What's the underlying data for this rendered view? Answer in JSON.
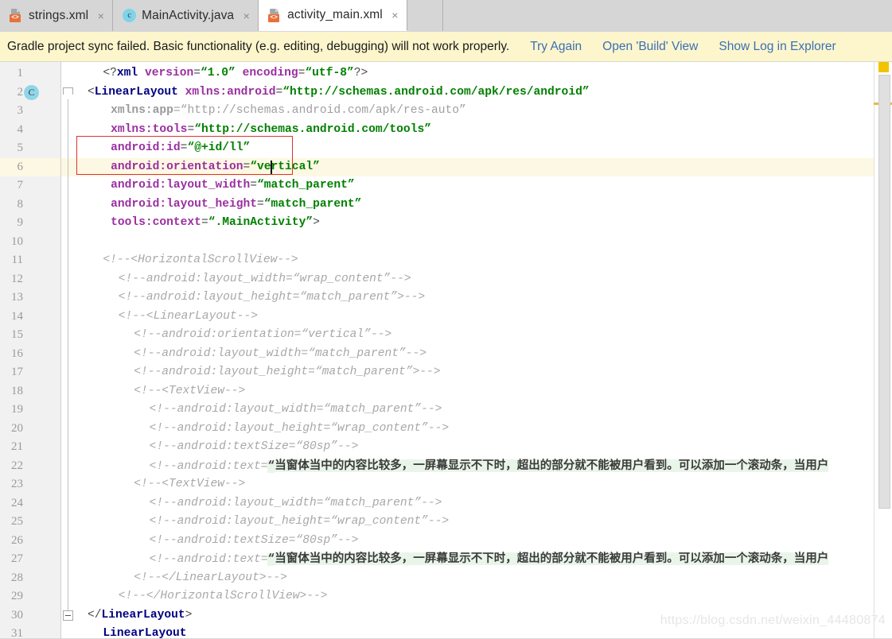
{
  "tabs": [
    {
      "label": "strings.xml",
      "icon": "xml-file-icon",
      "active": false,
      "close": "×"
    },
    {
      "label": "MainActivity.java",
      "icon": "java-class-icon",
      "active": false,
      "close": "×"
    },
    {
      "label": "activity_main.xml",
      "icon": "xml-file-icon",
      "active": true,
      "close": "×"
    }
  ],
  "notification": {
    "message": "Gradle project sync failed. Basic functionality (e.g. editing, debugging) will not work properly.",
    "links": [
      "Try Again",
      "Open 'Build' View",
      "Show Log in Explorer"
    ],
    "background": "#fdf6cd"
  },
  "editor": {
    "current_line": 6,
    "gutter_class_marker": "C",
    "caret_after": "vertical",
    "lines": [
      {
        "n": 1,
        "indent": 2,
        "segs": [
          {
            "t": "&lt;?",
            "c": "t-punc"
          },
          {
            "t": "xml",
            "c": "t-tag"
          },
          {
            "t": " ",
            "c": "t-punc"
          },
          {
            "t": "version",
            "c": "t-attr"
          },
          {
            "t": "=",
            "c": "t-punc"
          },
          {
            "t": "“1.0”",
            "c": "t-val"
          },
          {
            "t": " ",
            "c": "t-punc"
          },
          {
            "t": "encoding",
            "c": "t-attr"
          },
          {
            "t": "=",
            "c": "t-punc"
          },
          {
            "t": "“utf-8”",
            "c": "t-val"
          },
          {
            "t": "?&gt;",
            "c": "t-punc"
          }
        ]
      },
      {
        "n": 2,
        "indent": 0,
        "segs": [
          {
            "t": "&lt;",
            "c": "t-punc"
          },
          {
            "t": "LinearLayout",
            "c": "t-tag"
          },
          {
            "t": " ",
            "c": "t-punc"
          },
          {
            "t": "xmlns:android",
            "c": "t-attr"
          },
          {
            "t": "=",
            "c": "t-punc"
          },
          {
            "t": "“http://schemas.android.com/apk/res/android”",
            "c": "t-val"
          }
        ]
      },
      {
        "n": 3,
        "indent": 3,
        "segs": [
          {
            "t": "xmlns:app",
            "c": "t-grayb"
          },
          {
            "t": "=",
            "c": "t-gray"
          },
          {
            "t": "“http://schemas.android.com/apk/res-auto”",
            "c": "t-gray"
          }
        ]
      },
      {
        "n": 4,
        "indent": 3,
        "segs": [
          {
            "t": "xmlns:tools",
            "c": "t-attr"
          },
          {
            "t": "=",
            "c": "t-punc"
          },
          {
            "t": "“http://schemas.android.com/tools”",
            "c": "t-val"
          }
        ]
      },
      {
        "n": 5,
        "indent": 3,
        "segs": [
          {
            "t": "android:id",
            "c": "t-attr"
          },
          {
            "t": "=",
            "c": "t-punc"
          },
          {
            "t": "“@+id/ll”",
            "c": "t-val"
          }
        ]
      },
      {
        "n": 6,
        "indent": 3,
        "segs": [
          {
            "t": "android:orientation",
            "c": "t-attr"
          },
          {
            "t": "=",
            "c": "t-punc"
          },
          {
            "t": "“vertical”",
            "c": "t-val"
          }
        ]
      },
      {
        "n": 7,
        "indent": 3,
        "segs": [
          {
            "t": "android:layout_width",
            "c": "t-attr"
          },
          {
            "t": "=",
            "c": "t-punc"
          },
          {
            "t": "“match_parent”",
            "c": "t-val"
          }
        ]
      },
      {
        "n": 8,
        "indent": 3,
        "segs": [
          {
            "t": "android:layout_height",
            "c": "t-attr"
          },
          {
            "t": "=",
            "c": "t-punc"
          },
          {
            "t": "“match_parent”",
            "c": "t-val"
          }
        ]
      },
      {
        "n": 9,
        "indent": 3,
        "segs": [
          {
            "t": "tools:context",
            "c": "t-attr"
          },
          {
            "t": "=",
            "c": "t-punc"
          },
          {
            "t": "“.MainActivity”",
            "c": "t-val"
          },
          {
            "t": "&gt;",
            "c": "t-punc"
          }
        ]
      },
      {
        "n": 10,
        "indent": 0,
        "segs": []
      },
      {
        "n": 11,
        "indent": 2,
        "segs": [
          {
            "t": "&lt;!--&lt;HorizontalScrollView--&gt;",
            "c": "t-cmt"
          }
        ]
      },
      {
        "n": 12,
        "indent": 4,
        "segs": [
          {
            "t": "&lt;!--android:layout_width=“wrap_content”--&gt;",
            "c": "t-cmt"
          }
        ]
      },
      {
        "n": 13,
        "indent": 4,
        "segs": [
          {
            "t": "&lt;!--android:layout_height=“match_parent”&gt;--&gt;",
            "c": "t-cmt"
          }
        ]
      },
      {
        "n": 14,
        "indent": 4,
        "segs": [
          {
            "t": "&lt;!--&lt;LinearLayout--&gt;",
            "c": "t-cmt"
          }
        ]
      },
      {
        "n": 15,
        "indent": 6,
        "segs": [
          {
            "t": "&lt;!--android:orientation=“vertical”--&gt;",
            "c": "t-cmt"
          }
        ]
      },
      {
        "n": 16,
        "indent": 6,
        "segs": [
          {
            "t": "&lt;!--android:layout_width=“match_parent”--&gt;",
            "c": "t-cmt"
          }
        ]
      },
      {
        "n": 17,
        "indent": 6,
        "segs": [
          {
            "t": "&lt;!--android:layout_height=“match_parent”&gt;--&gt;",
            "c": "t-cmt"
          }
        ]
      },
      {
        "n": 18,
        "indent": 6,
        "segs": [
          {
            "t": "&lt;!--&lt;TextView--&gt;",
            "c": "t-cmt"
          }
        ]
      },
      {
        "n": 19,
        "indent": 8,
        "segs": [
          {
            "t": "&lt;!--android:layout_width=“match_parent”--&gt;",
            "c": "t-cmt"
          }
        ]
      },
      {
        "n": 20,
        "indent": 8,
        "segs": [
          {
            "t": "&lt;!--android:layout_height=“wrap_content”--&gt;",
            "c": "t-cmt"
          }
        ]
      },
      {
        "n": 21,
        "indent": 8,
        "segs": [
          {
            "t": "&lt;!--android:textSize=“80sp”--&gt;",
            "c": "t-cmt"
          }
        ]
      },
      {
        "n": 22,
        "indent": 8,
        "segs": [
          {
            "t": "&lt;!--android:text=",
            "c": "t-cmt"
          },
          {
            "t": "“",
            "c": "t-cnq"
          },
          {
            "t": "当窗体当中的内容比较多，一屏幕显示不下时，超出的部分就不能被用户看到。可以添加一个滚动条，当用户",
            "c": "t-cn"
          }
        ]
      },
      {
        "n": 23,
        "indent": 6,
        "segs": [
          {
            "t": "&lt;!--&lt;TextView--&gt;",
            "c": "t-cmt"
          }
        ]
      },
      {
        "n": 24,
        "indent": 8,
        "segs": [
          {
            "t": "&lt;!--android:layout_width=“match_parent”--&gt;",
            "c": "t-cmt"
          }
        ]
      },
      {
        "n": 25,
        "indent": 8,
        "segs": [
          {
            "t": "&lt;!--android:layout_height=“wrap_content”--&gt;",
            "c": "t-cmt"
          }
        ]
      },
      {
        "n": 26,
        "indent": 8,
        "segs": [
          {
            "t": "&lt;!--android:textSize=“80sp”--&gt;",
            "c": "t-cmt"
          }
        ]
      },
      {
        "n": 27,
        "indent": 8,
        "segs": [
          {
            "t": "&lt;!--android:text=",
            "c": "t-cmt"
          },
          {
            "t": "“",
            "c": "t-cnq"
          },
          {
            "t": "当窗体当中的内容比较多，一屏幕显示不下时，超出的部分就不能被用户看到。可以添加一个滚动条，当用户",
            "c": "t-cn"
          }
        ]
      },
      {
        "n": 28,
        "indent": 6,
        "segs": [
          {
            "t": "&lt;!--&lt;/LinearLayout&gt;--&gt;",
            "c": "t-cmt"
          }
        ]
      },
      {
        "n": 29,
        "indent": 4,
        "segs": [
          {
            "t": "&lt;!--&lt;/HorizontalScrollView&gt;--&gt;",
            "c": "t-cmt"
          }
        ]
      },
      {
        "n": 30,
        "indent": 0,
        "segs": [
          {
            "t": "&lt;/",
            "c": "t-punc"
          },
          {
            "t": "LinearLayout",
            "c": "t-tag"
          },
          {
            "t": "&gt;",
            "c": "t-punc"
          }
        ]
      },
      {
        "n": 31,
        "indent": 2,
        "segs": [
          {
            "t": "LinearLayout",
            "c": "t-tag"
          }
        ]
      }
    ]
  },
  "scrollbar": {
    "warning_marker_color": "#f2c300",
    "error_stripe_mark_color": "#e8b84b"
  },
  "watermark": "https://blog.csdn.net/weixin_44480874"
}
